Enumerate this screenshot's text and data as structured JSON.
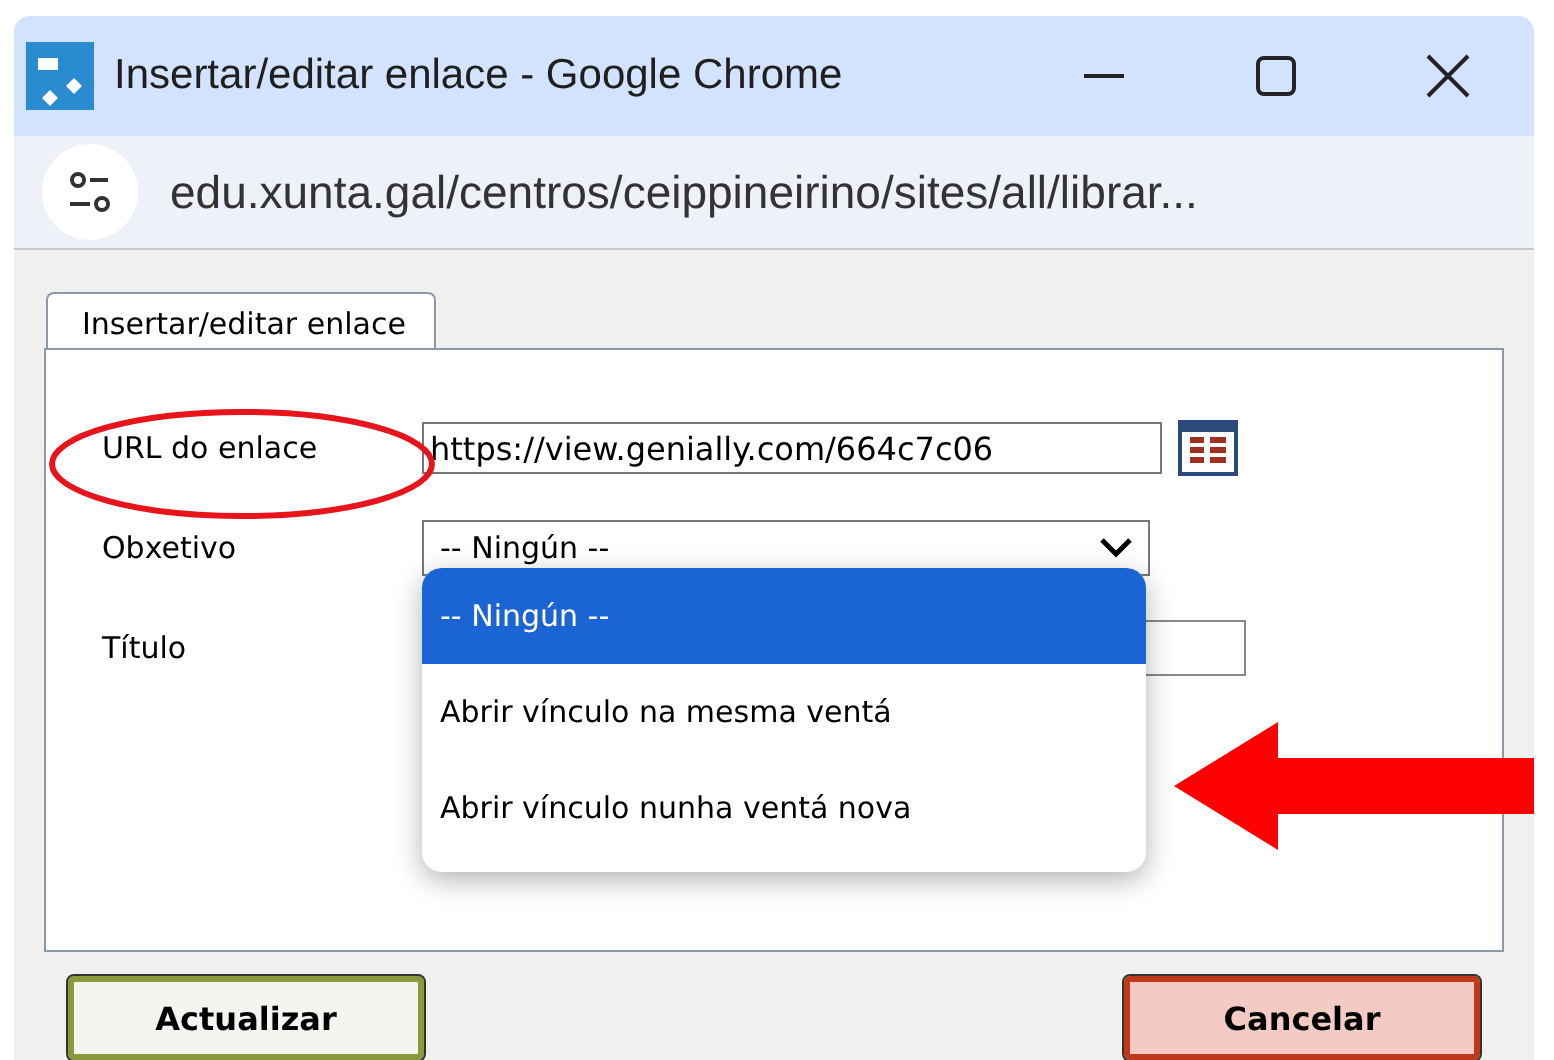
{
  "window": {
    "title": "Insertar/editar enlace - Google Chrome"
  },
  "address_bar": {
    "url": "edu.xunta.gal/centros/ceippineirino/sites/all/librar..."
  },
  "tabs": [
    {
      "label": "Insertar/editar enlace",
      "selected": true
    }
  ],
  "form": {
    "url_label": "URL do enlace",
    "url_value": "https://view.genially.com/664c7c06",
    "target_label": "Obxetivo",
    "target_value": "-- Ningún --",
    "title_label": "Título",
    "dropdown_open": true,
    "options": [
      {
        "label": "-- Ningún --",
        "selected": true
      },
      {
        "label": "Abrir vínculo na mesma ventá",
        "selected": false
      },
      {
        "label": "Abrir vínculo nunha ventá nova",
        "selected": false
      }
    ]
  },
  "buttons": [
    {
      "label": "Actualizar",
      "kind": "confirm"
    },
    {
      "label": "Cancelar",
      "kind": "cancel"
    }
  ],
  "annotations": {
    "ellipse": true,
    "arrow": true
  }
}
